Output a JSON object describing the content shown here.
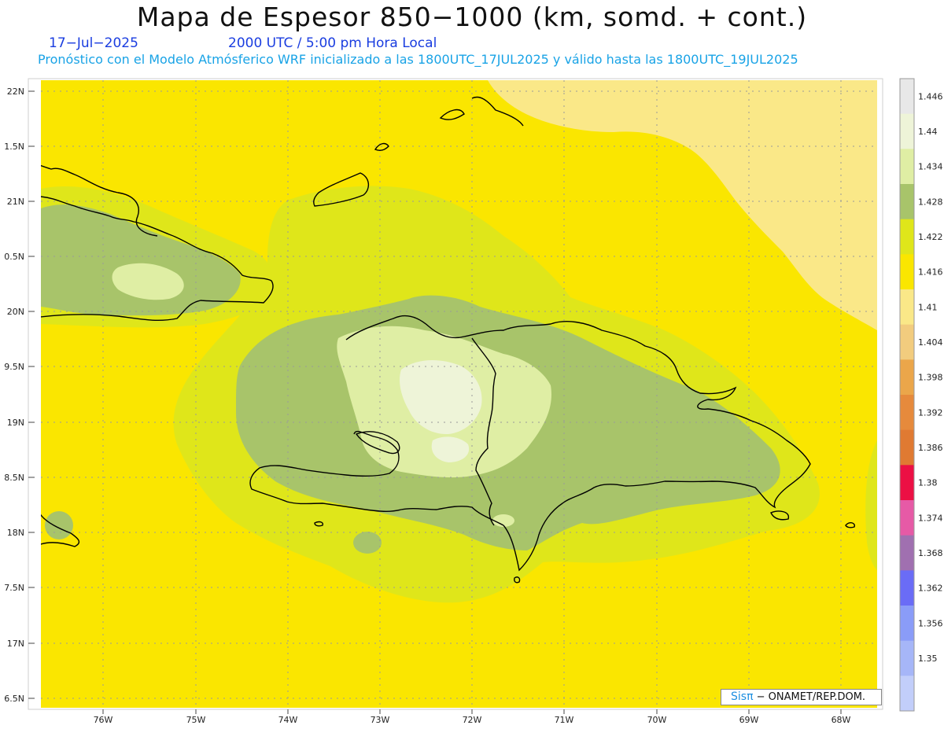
{
  "header": {
    "title": "Mapa de Espesor 850−1000 (km, somd. + cont.)",
    "date": "17−Jul−2025",
    "time": "2000 UTC / 5:00 pm Hora Local",
    "forecast": "Pronóstico con el Modelo Atmósferico WRF inicializado a las 1800UTC_17JUL2025 y válido hasta las  1800UTC_19JUL2025"
  },
  "credit": {
    "brand": "Sisπ",
    "text": "− ONAMET/REP.DOM."
  },
  "axes": {
    "lat_labels": [
      "22N",
      "1.5N",
      "21N",
      "0.5N",
      "20N",
      "9.5N",
      "19N",
      "8.5N",
      "18N",
      "7.5N",
      "17N",
      "6.5N"
    ],
    "lon_labels": [
      "76W",
      "75W",
      "74W",
      "73W",
      "72W",
      "71W",
      "70W",
      "69W",
      "68W"
    ]
  },
  "legend": {
    "labels": [
      "1.446",
      "1.44",
      "1.434",
      "1.428",
      "1.422",
      "1.416",
      "1.41",
      "1.404",
      "1.398",
      "1.392",
      "1.386",
      "1.38",
      "1.374",
      "1.368",
      "1.362",
      "1.356",
      "1.35"
    ],
    "colors": [
      "#e8e8e8",
      "#eef4d8",
      "#dfeea4",
      "#a8c46a",
      "#dfe61a",
      "#fae600",
      "#fae888",
      "#f2cc7e",
      "#eba64a",
      "#e68a3c",
      "#e07a32",
      "#ec1044",
      "#e65aa6",
      "#a070b0",
      "#6a6cf6",
      "#8a9cf8",
      "#a6b6f8",
      "#c2cefa"
    ]
  },
  "colors": {
    "level_1_416": "#fae600",
    "level_1_422": "#dfe61a",
    "level_1_428": "#a8c46a",
    "level_1_434": "#dfeea4",
    "level_1_44": "#eef4d8",
    "level_1_41": "#fae888",
    "coastline": "#000000"
  }
}
